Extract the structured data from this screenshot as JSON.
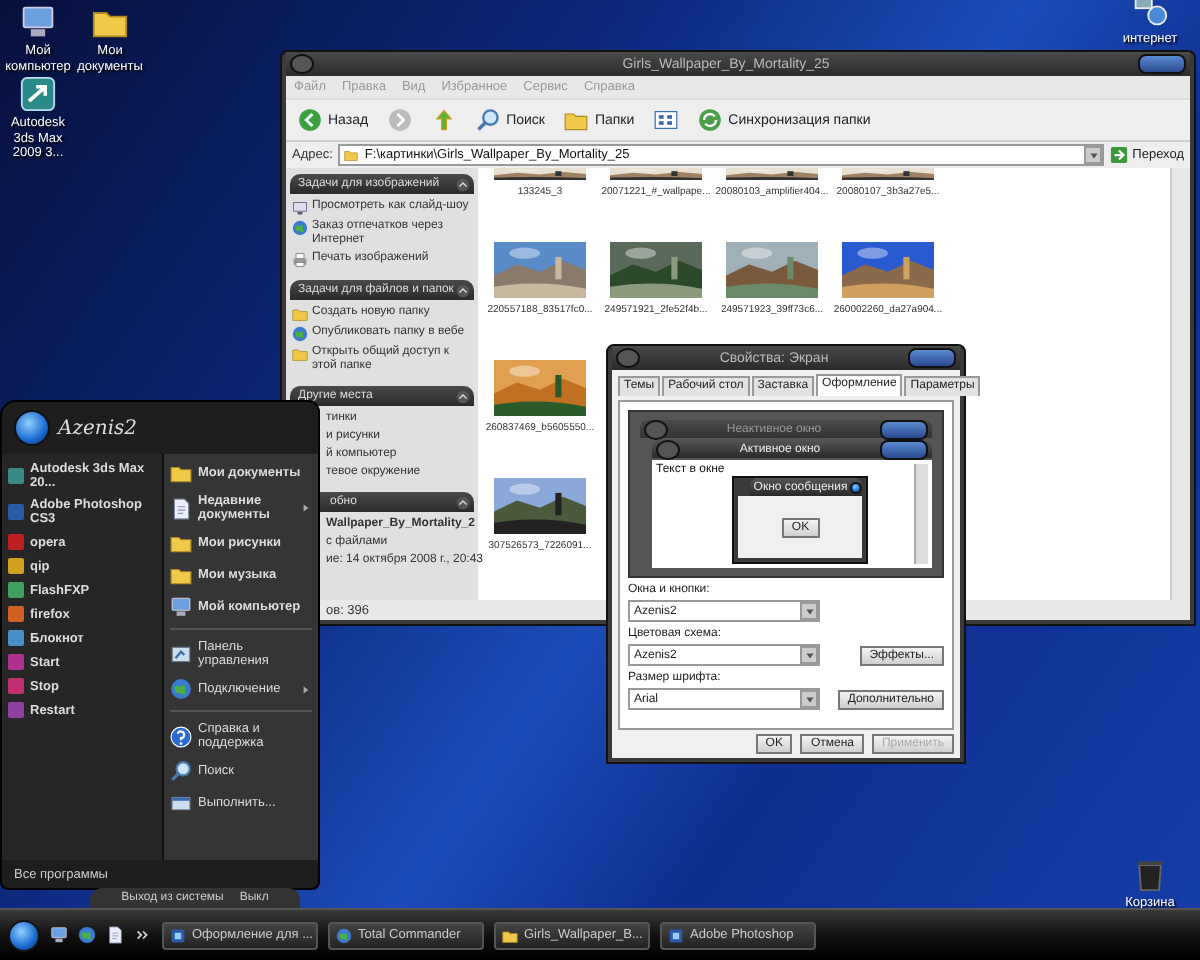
{
  "desktop_icons": [
    {
      "label": "Мой компьютер",
      "kind": "computer"
    },
    {
      "label": "Мои документы",
      "kind": "folder"
    },
    {
      "label": "Autodesk 3ds Max 2009 3...",
      "kind": "shortcut"
    },
    {
      "label": "интернет",
      "kind": "network"
    },
    {
      "label": "Корзина",
      "kind": "bin"
    }
  ],
  "explorer": {
    "title": "Girls_Wallpaper_By_Mortality_25",
    "menu": [
      "Файл",
      "Правка",
      "Вид",
      "Избранное",
      "Сервис",
      "Справка"
    ],
    "toolbar": [
      {
        "label": "Назад",
        "kind": "back"
      },
      {
        "kind": "forward"
      },
      {
        "kind": "up"
      },
      {
        "label": "Поиск",
        "kind": "search"
      },
      {
        "label": "Папки",
        "kind": "folder"
      },
      {
        "kind": "views"
      },
      {
        "label": "Синхронизация папки",
        "kind": "sync"
      }
    ],
    "address_label": "Адрес:",
    "address": "F:\\картинки\\Girls_Wallpaper_By_Mortality_25",
    "go": "Переход",
    "panels": [
      {
        "title": "Задачи для изображений",
        "kind": "plain",
        "items": [
          {
            "label": "Просмотреть как слайд-шоу",
            "kind": "monitor"
          },
          {
            "label": "Заказ отпечатков через Интернет",
            "kind": "globe"
          },
          {
            "label": "Печать изображений",
            "kind": "printer"
          }
        ]
      },
      {
        "title": "Задачи для файлов и папок",
        "kind": "plain",
        "items": [
          {
            "label": "Создать новую папку",
            "kind": "folder"
          },
          {
            "label": "Опубликовать папку в вебе",
            "kind": "globe"
          },
          {
            "label": "Открыть общий доступ к этой папке",
            "kind": "folder"
          }
        ]
      },
      {
        "title": "Другие места",
        "kind": "plain",
        "items": [
          {
            "label": "тинки",
            "kind": "hidden"
          },
          {
            "label": "и рисунки",
            "kind": "hidden"
          },
          {
            "label": "й компьютер",
            "kind": "hidden"
          },
          {
            "label": "тевое окружение",
            "kind": "hidden"
          }
        ]
      },
      {
        "title": "обно",
        "kind": "covered",
        "items": [
          {
            "label": "Wallpaper_By_Mortality_2",
            "kind": "bold"
          },
          {
            "label": "с файлами",
            "kind": "hidden"
          },
          {
            "label": "ие: 14 октября 2008 г., 20:43",
            "kind": "hidden"
          }
        ]
      }
    ],
    "thumbnail_rows": [
      [
        {
          "label": "133245_3",
          "kind": "cut"
        },
        {
          "label": "20071221_#_wallpape...",
          "kind": "cut"
        },
        {
          "label": "20080103_amplifier404...",
          "kind": "cut"
        },
        {
          "label": "20080107_3b3a27e5...",
          "kind": "cut"
        }
      ],
      [
        {
          "label": "220557188_83517fc0...",
          "kind": "city"
        },
        {
          "label": "249571921_2fe52f4b...",
          "kind": "forest"
        },
        {
          "label": "249571923_39ff73c6...",
          "kind": "river"
        },
        {
          "label": "260002260_da27a904...",
          "kind": "mountain"
        }
      ],
      [
        {
          "label": "260837469_b5605550...",
          "kind": "field"
        }
      ],
      [
        {
          "label": "307526573_7226091...",
          "kind": "windmill"
        }
      ]
    ],
    "status": "ов: 396"
  },
  "start_menu": {
    "user": "Azenis2",
    "programs": [
      {
        "label": "Autodesk 3ds Max 20...",
        "color": "#3a8a8a"
      },
      {
        "label": "Adobe Photoshop CS3",
        "color": "#2a5aa8"
      },
      {
        "label": "opera",
        "color": "#c02020"
      },
      {
        "label": "qip",
        "color": "#d0a020"
      },
      {
        "label": "FlashFXP",
        "color": "#40a060"
      },
      {
        "label": "firefox",
        "color": "#d06020"
      },
      {
        "label": "Блокнот",
        "color": "#4a90c8"
      },
      {
        "label": "Start",
        "color": "#b03090"
      },
      {
        "label": "Stop",
        "color": "#c03070"
      },
      {
        "label": "Restart",
        "color": "#9040a0"
      }
    ],
    "all_programs": "Все программы",
    "places": [
      {
        "label": "Мои документы",
        "kind": "folder",
        "bold": true,
        "submenu": false
      },
      {
        "label": "Недавние документы",
        "kind": "document",
        "bold": true,
        "submenu": true
      },
      {
        "label": "Мои рисунки",
        "kind": "folder",
        "bold": true,
        "submenu": false
      },
      {
        "label": "Мои музыка",
        "kind": "folder",
        "bold": true,
        "submenu": false
      },
      {
        "label": "Мой компьютер",
        "kind": "computer",
        "bold": true,
        "submenu": false
      },
      {
        "label": "Панель управления",
        "kind": "panel",
        "bold": false,
        "submenu": false
      },
      {
        "label": "Подключение",
        "kind": "globe",
        "bold": false,
        "submenu": true
      },
      {
        "label": "Справка и поддержка",
        "kind": "help",
        "bold": false,
        "submenu": false
      },
      {
        "label": "Поиск",
        "kind": "search",
        "bold": false,
        "submenu": false
      },
      {
        "label": "Выполнить...",
        "kind": "run",
        "bold": false,
        "submenu": false
      }
    ],
    "logoff": "Выход из системы",
    "shutdown": "Выкл"
  },
  "dialog": {
    "title": "Свойства: Экран",
    "tabs": [
      {
        "label": "Темы",
        "selected": false
      },
      {
        "label": "Рабочий стол",
        "selected": false
      },
      {
        "label": "Заставка",
        "selected": false
      },
      {
        "label": "Оформление",
        "selected": true
      },
      {
        "label": "Параметры",
        "selected": false
      }
    ],
    "preview": {
      "inactive": "Неактивное окно",
      "active": "Активное окно",
      "text": "Текст в окне",
      "message": "Окно сообщения",
      "ok": "OK"
    },
    "fields": [
      {
        "label": "Окна и кнопки:",
        "value": "Azenis2"
      },
      {
        "label": "Цветовая схема:",
        "value": "Azenis2"
      },
      {
        "label": "Размер шрифта:",
        "value": "Arial"
      }
    ],
    "side_buttons": [
      "Эффекты...",
      "Дополнительно"
    ],
    "buttons": [
      {
        "label": "OK",
        "disabled": false
      },
      {
        "label": "Отмена",
        "disabled": false
      },
      {
        "label": "Применить",
        "disabled": true
      }
    ]
  },
  "taskbar": {
    "quick_launch": [
      {
        "kind": "computer"
      },
      {
        "kind": "globe"
      },
      {
        "kind": "document"
      },
      {
        "kind": "more"
      }
    ],
    "tasks": [
      {
        "label": "Оформление для ...",
        "kind": "app"
      },
      {
        "label": "Total Commander",
        "kind": "globe"
      },
      {
        "label": "Girls_Wallpaper_B...",
        "kind": "folder"
      },
      {
        "label": "Adobe Photoshop",
        "kind": "app"
      }
    ]
  }
}
